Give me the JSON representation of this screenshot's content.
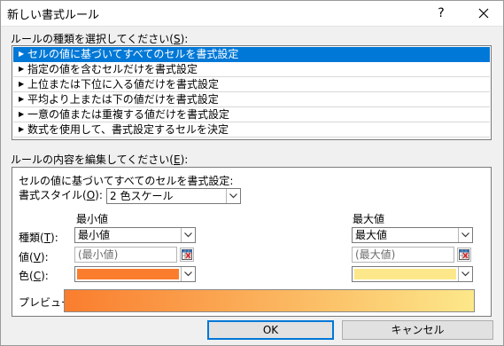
{
  "window": {
    "title": "新しい書式ルール",
    "help_label": "?"
  },
  "rule_type": {
    "label": "ルールの種類を選択してください(",
    "accel": "S",
    "label_end": "):",
    "items": [
      {
        "label": "セルの値に基づいてすべてのセルを書式設定",
        "selected": true
      },
      {
        "label": "指定の値を含むセルだけを書式設定"
      },
      {
        "label": "上位または下位に入る値だけを書式設定"
      },
      {
        "label": "平均より上または下の値だけを書式設定"
      },
      {
        "label": "一意の値または重複する値だけを書式設定"
      },
      {
        "label": "数式を使用して、書式設定するセルを決定"
      }
    ]
  },
  "rule_edit": {
    "label": "ルールの内容を編集してください(",
    "accel": "E",
    "label_end": "):",
    "description": "セルの値に基づいてすべてのセルを書式設定:",
    "format_style": {
      "label": "書式スタイル(",
      "accel": "O",
      "label_end": "):",
      "value": "2 色スケール"
    },
    "min_header": "最小値",
    "max_header": "最大値",
    "type_label": {
      "label": "種類(",
      "accel": "T",
      "label_end": "):"
    },
    "value_label": {
      "label": "値(",
      "accel": "V",
      "label_end": "):"
    },
    "color_label": {
      "label": "色(",
      "accel": "C",
      "label_end": "):"
    },
    "min_type": "最小値",
    "max_type": "最大値",
    "min_value": "(最小値)",
    "max_value": "(最大値)",
    "min_color": "#fa7d2e",
    "max_color": "#fce88a",
    "preview_label": "プレビュー:"
  },
  "buttons": {
    "ok": "OK",
    "cancel": "キャンセル"
  }
}
